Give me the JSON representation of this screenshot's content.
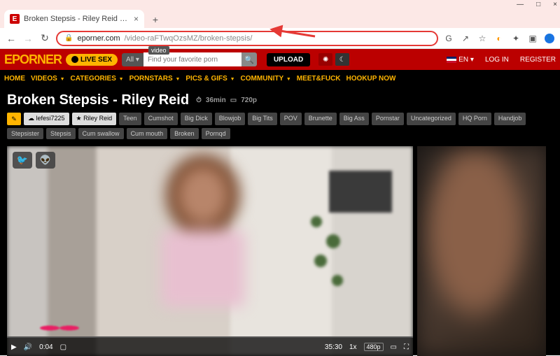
{
  "window": {
    "min": "—",
    "max": "□",
    "close": "×"
  },
  "tab": {
    "favicon": "E",
    "title": "Broken Stepsis - Riley Reid – E",
    "close": "×",
    "new": "+"
  },
  "addr": {
    "back": "←",
    "fwd": "→",
    "reload": "↻",
    "lock": "🔒",
    "domain": "eporner.com",
    "path": "/video-raFTwqOzsMZ/broken-stepsis/",
    "tip": "video"
  },
  "ext": {
    "g": "G",
    "share": "↗",
    "star": "☆",
    "s": "◐",
    "puzzle": "✦",
    "sq": "▣",
    "user": "👤"
  },
  "hdr": {
    "logo": "EPORNER",
    "livesex": "LIVE SEX",
    "all": "All ▾",
    "search_ph": "Find your favorite porn",
    "search_icon": "🔍",
    "upload": "UPLOAD",
    "gear": "✺",
    "moon": "☾",
    "lang": "EN ▾",
    "login": "LOG IN",
    "register": "REGISTER"
  },
  "nav": {
    "home": "HOME",
    "videos": "VIDEOS",
    "categories": "CATEGORIES",
    "pornstars": "PORNSTARS",
    "pics": "PICS & GIFS",
    "community": "COMMUNITY",
    "meet": "MEET&FUCK",
    "hookup": "HOOKUP NOW"
  },
  "video": {
    "title": "Broken Stepsis - Riley Reid",
    "dur": "36min",
    "res": "720p",
    "edit": "✎",
    "uploader": "lefesi7225",
    "star": "Riley Reid"
  },
  "tags": [
    "Teen",
    "Cumshot",
    "Big Dick",
    "Blowjob",
    "Big Tits",
    "POV",
    "Brunette",
    "Big Ass",
    "Pornstar",
    "Uncategorized",
    "HQ Porn",
    "Handjob",
    "Stepsister",
    "Stepsis",
    "Cum swallow",
    "Cum mouth",
    "Broken",
    "Pornqd"
  ],
  "social": {
    "tw": "🐦",
    "rd": "👽"
  },
  "ctrl": {
    "play": "▶",
    "vol": "🔊",
    "cur": "0:04",
    "pic": "▢",
    "total": "35:30",
    "speed": "1x",
    "q": "480p",
    "cc": "▭",
    "full": "⛶"
  }
}
